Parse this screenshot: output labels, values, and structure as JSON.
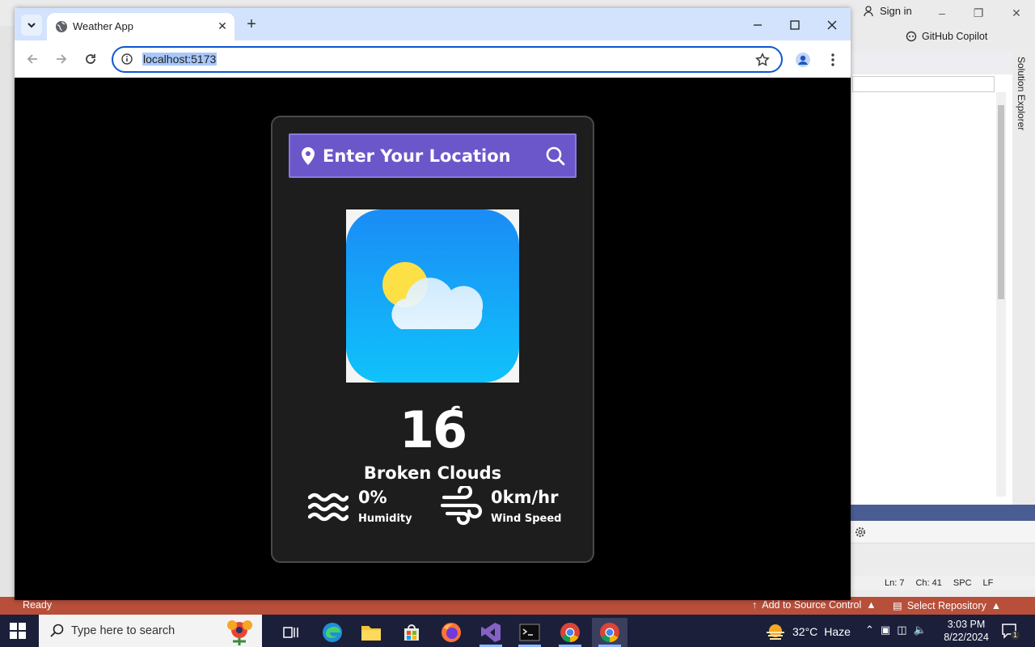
{
  "browser": {
    "tab_title": "Weather App",
    "url": "localhost:5173"
  },
  "weather": {
    "search_placeholder": "Enter Your Location",
    "temperature": "16",
    "temperature_unit": "c",
    "condition": "Broken Clouds",
    "humidity_value": "0%",
    "humidity_label": "Humidity",
    "wind_value": "0km/hr",
    "wind_label": "Wind Speed"
  },
  "vs": {
    "sign_in": "Sign in",
    "copilot": "GitHub Copilot",
    "solution_explorer": "Solution Explorer",
    "status_ready": "Ready",
    "add_source_control": "Add to Source Control",
    "select_repository": "Select Repository",
    "ln": "Ln: 7",
    "ch": "Ch: 41",
    "spc": "SPC",
    "lf": "LF"
  },
  "taskbar": {
    "search_placeholder": "Type here to search",
    "weather_temp": "32°C",
    "weather_cond": "Haze",
    "time": "3:03 PM",
    "date": "8/22/2024",
    "notif_count": "1"
  },
  "colors": {
    "search_bar": "#6b57c9",
    "card_bg": "#1d1d1d",
    "vs_status": "#b74f3a",
    "taskbar": "#1b1f3a"
  }
}
